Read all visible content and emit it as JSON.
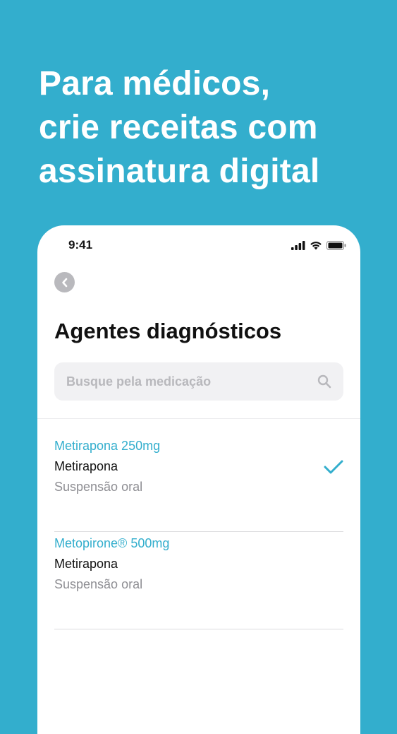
{
  "headline": {
    "line1": "Para médicos,",
    "line2": "crie receitas com",
    "line3": "assinatura digital"
  },
  "status_bar": {
    "time": "9:41",
    "icons": [
      "signal-icon",
      "wifi-icon",
      "battery-icon"
    ]
  },
  "screen": {
    "back_icon": "chevron-left-icon",
    "title": "Agentes diagnósticos",
    "search": {
      "placeholder": "Busque pela medicação",
      "value": "",
      "icon": "search-icon"
    },
    "items": [
      {
        "name": "Metirapona 250mg",
        "generic": "Metirapona",
        "form": "Suspensão oral",
        "selected": true
      },
      {
        "name": "Metopirone® 500mg",
        "generic": "Metirapona",
        "form": "Suspensão oral",
        "selected": false
      }
    ]
  },
  "colors": {
    "background": "#33AECD",
    "accent": "#33AECD",
    "card": "#FFFFFF"
  }
}
